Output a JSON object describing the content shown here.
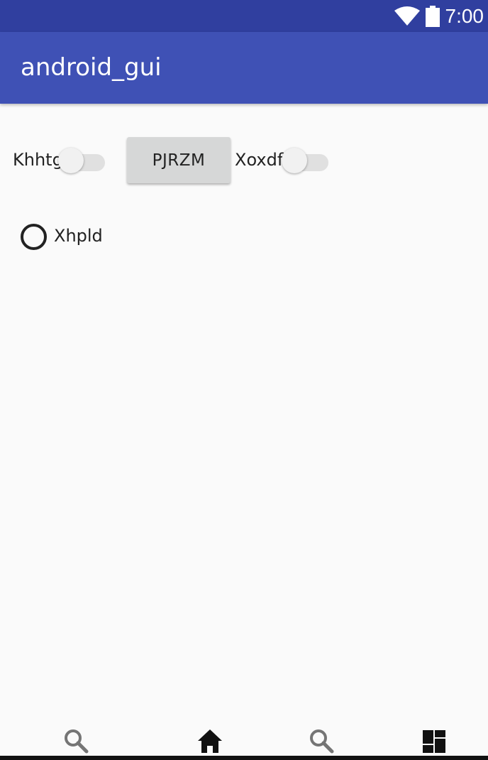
{
  "status_bar": {
    "time": "7:00",
    "icons": [
      "wifi-icon",
      "battery-icon"
    ],
    "color": "#303f9f"
  },
  "app_bar": {
    "title": "android_gui",
    "color": "#3f51b5"
  },
  "controls": {
    "switch_1": {
      "label": "Khhtg",
      "checked": false
    },
    "button": {
      "label": "PJRZM"
    },
    "switch_2": {
      "label": "Xoxdf",
      "checked": false
    },
    "radio": {
      "label": "Xhpld",
      "checked": false
    }
  },
  "bottom_nav": {
    "items": [
      {
        "icon": "search-icon"
      },
      {
        "icon": "home-icon"
      },
      {
        "icon": "search-icon"
      },
      {
        "icon": "dashboard-icon"
      }
    ]
  }
}
